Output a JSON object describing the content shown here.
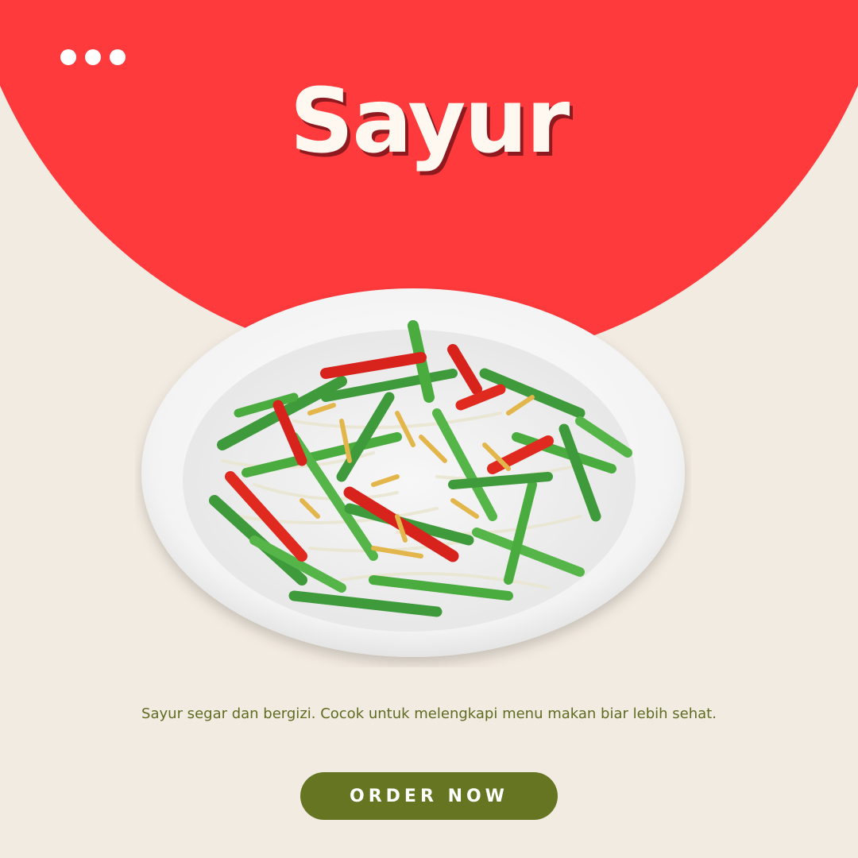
{
  "header": {
    "menu_icon": "more-dots-icon",
    "title": "Sayur"
  },
  "hero": {
    "image": "stir-fried-green-beans-plate-image"
  },
  "content": {
    "tagline": "Sayur segar dan bergizi. Cocok untuk melengkapi menu makan biar lebih sehat."
  },
  "cta": {
    "label": "ORDER NOW"
  },
  "colors": {
    "background": "#F2EBE1",
    "accent_red": "#FF3A3C",
    "title_shadow": "#8E1A1F",
    "button": "#667522",
    "tagline": "#5E6B20"
  }
}
